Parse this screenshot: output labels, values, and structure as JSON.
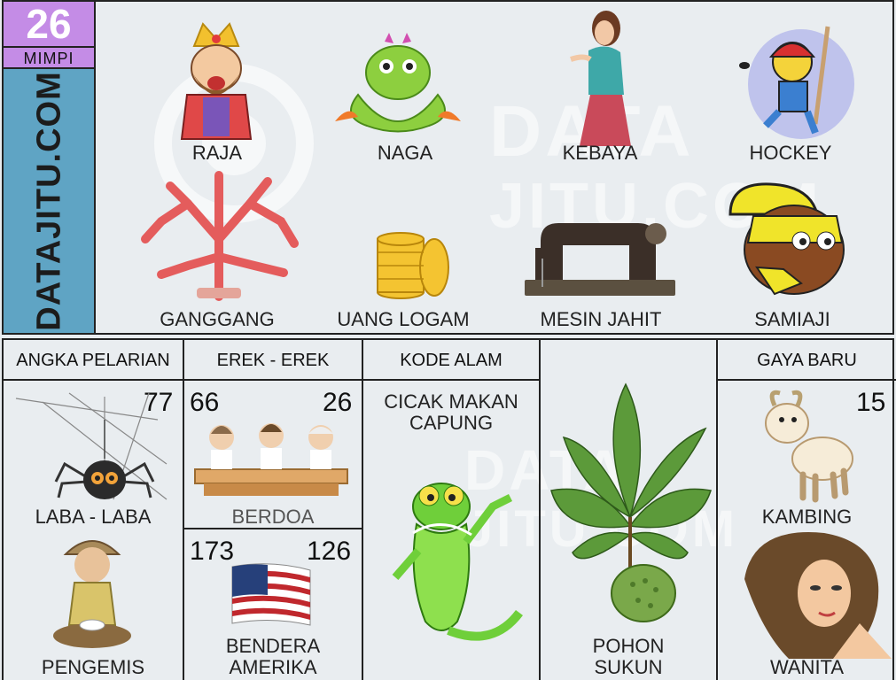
{
  "header": {
    "number": "26",
    "mimpi_label": "MIMPI",
    "brand": "DATAJITU.COM"
  },
  "watermark": {
    "line1": "DATA",
    "line2": "JITU.COM"
  },
  "top_items": [
    {
      "label": "RAJA",
      "icon": "king-icon"
    },
    {
      "label": "NAGA",
      "icon": "dragon-icon"
    },
    {
      "label": "KEBAYA",
      "icon": "kebaya-woman-icon"
    },
    {
      "label": "HOCKEY",
      "icon": "hockey-player-icon"
    },
    {
      "label": "GANGGANG",
      "icon": "coral-icon"
    },
    {
      "label": "UANG LOGAM",
      "icon": "coins-icon"
    },
    {
      "label": "MESIN JAHIT",
      "icon": "sewing-machine-icon"
    },
    {
      "label": "SAMIAJI",
      "icon": "helmet-character-icon"
    }
  ],
  "sections": {
    "angka_pelarian": {
      "header": "ANGKA PELARIAN",
      "number": "77",
      "item1_label": "LABA - LABA",
      "item2_label": "PENGEMIS"
    },
    "erek_erek": {
      "header": "EREK - EREK",
      "upper_left": "66",
      "upper_right": "26",
      "upper_label": "BERDOA",
      "lower_left": "173",
      "lower_right": "126",
      "lower_label_line1": "BENDERA",
      "lower_label_line2": "AMERIKA"
    },
    "kode_alam": {
      "header": "KODE ALAM",
      "title_line1": "CICAK MAKAN",
      "title_line2": "CAPUNG"
    },
    "pohon": {
      "label_line1": "POHON",
      "label_line2": "SUKUN"
    },
    "gaya_baru": {
      "header": "GAYA BARU",
      "number": "15",
      "item1_label": "KAMBING",
      "item2_label": "WANITA"
    }
  },
  "colors": {
    "accent_purple": "#c48ce6",
    "brand_blue": "#5fa4c4",
    "background": "#e9edf0"
  }
}
